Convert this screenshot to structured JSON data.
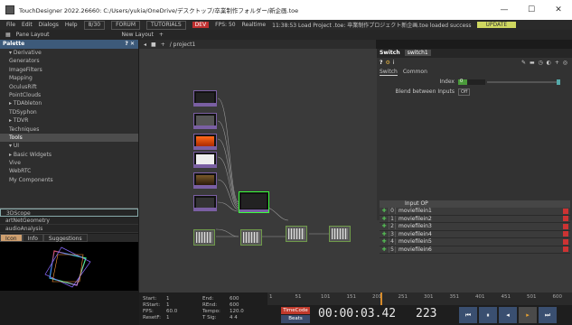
{
  "window": {
    "title": "TouchDesigner 2022.26660: C:/Users/yukia/OneDrive/デスクトップ/卒業制作フォルダー/新企画.toe",
    "minimize": "—",
    "maximize": "☐",
    "close": "✕"
  },
  "menubar": {
    "items": [
      "File",
      "Edit",
      "Dialogs",
      "Help"
    ],
    "tag_box": "8/30",
    "forum": "FORUM",
    "tutorials": "TUTORIALS",
    "dev": "DEV",
    "fps_label": "FPS: 50",
    "realtime": "Realtime",
    "status": "11:38:53 Load Project .toe: 卒業制作プロジェクト新企画.toe loaded success",
    "update": "UPDATE"
  },
  "toolbar": {
    "pane_layout": "Pane Layout",
    "new_layout": "New Layout"
  },
  "palette": {
    "title": "Palette",
    "items": [
      {
        "label": "▾ Derivative",
        "sel": false
      },
      {
        "label": "Generators",
        "sel": false
      },
      {
        "label": "ImageFilters",
        "sel": false
      },
      {
        "label": "Mapping",
        "sel": false
      },
      {
        "label": "OculusRift",
        "sel": false
      },
      {
        "label": "PointClouds",
        "sel": false
      },
      {
        "label": "▸ TDAbleton",
        "sel": false
      },
      {
        "label": "TDSyphon",
        "sel": false
      },
      {
        "label": "▸ TDVR",
        "sel": false
      },
      {
        "label": "Techniques",
        "sel": false
      },
      {
        "label": "Tools",
        "sel": true
      },
      {
        "label": "▾ UI",
        "sel": false
      },
      {
        "label": "▸ Basic Widgets",
        "sel": false
      },
      {
        "label": "Vive",
        "sel": false
      },
      {
        "label": "WebRTC",
        "sel": false
      },
      {
        "label": "My Components",
        "sel": false
      }
    ]
  },
  "bookmarks": {
    "items": [
      "3DScope",
      "artNetGeometry",
      "audioAnalysis"
    ]
  },
  "preview_tabs": [
    "Icon",
    "Info",
    "Suggestions"
  ],
  "network": {
    "path": "/ project1"
  },
  "param": {
    "op_type": "Switch",
    "op_name": "switch1",
    "tabs": [
      "Switch",
      "Common"
    ],
    "index_label": "Index",
    "index_value": "0",
    "blend_label": "Blend between Inputs",
    "blend_value": "Off",
    "input_header": "Input OP",
    "inputs": [
      {
        "idx": "0",
        "name": "moviefilein1"
      },
      {
        "idx": "1",
        "name": "moviefilein2"
      },
      {
        "idx": "2",
        "name": "moviefilein3"
      },
      {
        "idx": "3",
        "name": "moviefilein4"
      },
      {
        "idx": "4",
        "name": "moviefilein5"
      },
      {
        "idx": "5",
        "name": "moviefilein6"
      }
    ]
  },
  "timeline": {
    "start_label": "Start:",
    "start_value": "1",
    "rstart_label": "RStart:",
    "rstart_value": "1",
    "fps_label": "FPS:",
    "fps_value": "60.0",
    "resetf_label": "ResetF:",
    "resetf_value": "1",
    "end_label": "End:",
    "end_value": "600",
    "rend_label": "REnd:",
    "rend_value": "600",
    "tempo_label": "Tempo:",
    "tempo_value": "120.0",
    "tsig_label": "T Sig:",
    "tsig_value": "4   4",
    "ruler_ticks": [
      "1",
      "51",
      "101",
      "151",
      "201",
      "251",
      "301",
      "351",
      "401",
      "451",
      "501",
      "600"
    ],
    "timecode_btn": "TimeCode",
    "beats_btn": "Beats",
    "timecode": "00:00:03.42",
    "frame": "223",
    "transport": [
      "⏮",
      "⏸",
      "◂",
      "▸",
      "⏭"
    ],
    "playhead_fraction": 0.37
  }
}
